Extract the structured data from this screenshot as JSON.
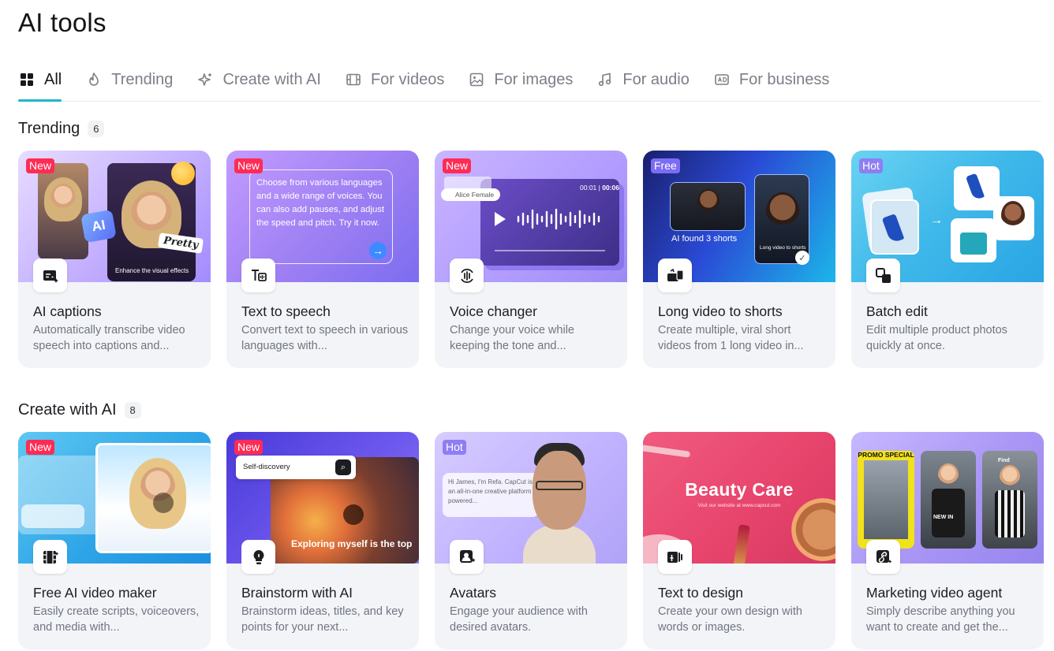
{
  "page": {
    "title": "AI tools"
  },
  "tabs": [
    {
      "label": "All",
      "icon": "grid-icon",
      "active": true
    },
    {
      "label": "Trending",
      "icon": "flame-icon",
      "active": false
    },
    {
      "label": "Create with AI",
      "icon": "sparkle-icon",
      "active": false
    },
    {
      "label": "For videos",
      "icon": "film-icon",
      "active": false
    },
    {
      "label": "For images",
      "icon": "image-icon",
      "active": false
    },
    {
      "label": "For audio",
      "icon": "music-note-icon",
      "active": false
    },
    {
      "label": "For business",
      "icon": "ad-icon",
      "active": false
    }
  ],
  "sections": [
    {
      "title": "Trending",
      "count": "6",
      "cards": [
        {
          "badge": "New",
          "title": "AI captions",
          "description": "Automatically transcribe video speech into captions and...",
          "icon": "captions-icon",
          "thumb": {
            "chip": "AI",
            "sticker": "Pretty",
            "caption": "Enhance the visual effects"
          }
        },
        {
          "badge": "New",
          "title": "Text to speech",
          "description": "Convert text to speech in various languages with...",
          "icon": "text-to-speech-icon",
          "thumb": {
            "text": "Choose from various languages and a wide range of voices. You can also add pauses, and adjust the speed and pitch. Try it now."
          }
        },
        {
          "badge": "New",
          "title": "Voice changer",
          "description": "Change your voice while keeping the tone and...",
          "icon": "voice-changer-icon",
          "thumb": {
            "voice_chip": "Alice Female",
            "time_current": "00:01",
            "time_total": "00:06"
          }
        },
        {
          "badge": "Free",
          "title": "Long video to shorts",
          "description": "Create multiple, viral short videos from 1 long video in...",
          "icon": "shorts-icon",
          "thumb": {
            "label": "AI found 3 shorts",
            "mini_caption": "Long video to shorts"
          }
        },
        {
          "badge": "Hot",
          "title": "Batch edit",
          "description": "Edit multiple product photos quickly at once.",
          "icon": "batch-edit-icon",
          "thumb": {}
        }
      ]
    },
    {
      "title": "Create with AI",
      "count": "8",
      "cards": [
        {
          "badge": "New",
          "title": "Free AI video maker",
          "description": "Easily create scripts, voiceovers, and media with...",
          "icon": "video-maker-icon",
          "thumb": {}
        },
        {
          "badge": "New",
          "title": "Brainstorm with AI",
          "description": "Brainstorm ideas, titles, and key points for your next...",
          "icon": "lightbulb-icon",
          "thumb": {
            "search_text": "Self-discovery",
            "overlay": "Exploring myself is the top"
          }
        },
        {
          "badge": "Hot",
          "title": "Avatars",
          "description": "Engage your audience with desired avatars.",
          "icon": "avatar-icon",
          "thumb": {
            "chat": "Hi James, I'm Refa. CapCut is an all-in-one creative platform powered..."
          }
        },
        {
          "badge": "",
          "title": "Text to design",
          "description": "Create your own design with words or images.",
          "icon": "text-to-design-icon",
          "thumb": {
            "headline": "Beauty Care",
            "sub": "Visit our website at www.capcut.com"
          }
        },
        {
          "badge": "",
          "title": "Marketing video agent",
          "description": "Simply describe anything you want to create and get the...",
          "icon": "marketing-agent-icon",
          "thumb": {
            "promo": "PROMO SPECIAL",
            "new_in": "NEW IN",
            "find": "Find"
          }
        }
      ]
    }
  ],
  "colors": {
    "accent": "#20b6c9",
    "badge_new": "#fe2c55",
    "badge_free": "#7c6cf3",
    "badge_hot": "#8e7ef2"
  }
}
